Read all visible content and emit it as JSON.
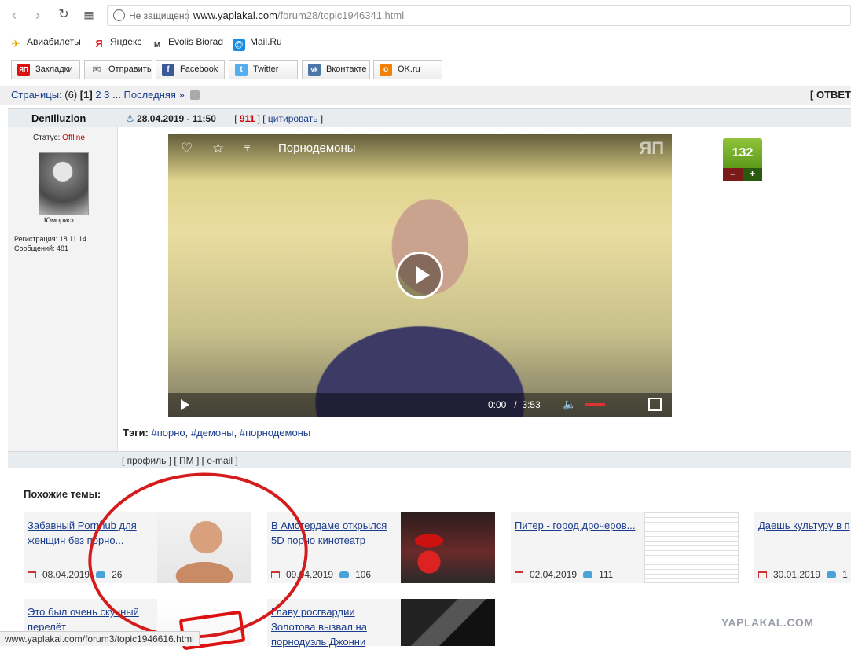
{
  "browser": {
    "security_label": "Не защищено",
    "url_domain": "www.yaplakal.com",
    "url_path": "/forum28/topic1946341.html",
    "bookmarks": [
      "Авиабилеты",
      "Яндекс",
      "Evolis Biorad",
      "Mail.Ru"
    ]
  },
  "share": {
    "buttons": [
      "Закладки",
      "Отправить",
      "Facebook",
      "Twitter",
      "Вконтакте",
      "OK.ru"
    ]
  },
  "pages": {
    "label": "Страницы:",
    "count": "(6)",
    "current": "[1]",
    "p2": "2",
    "p3": "3",
    "ellipsis": "...",
    "last": "Последняя »",
    "reply": "[ ОТВЕТ"
  },
  "post": {
    "author": "DenIlluzion",
    "datetime": "28.04.2019 - 11:50",
    "post_number": "911",
    "quote_label": "цитировать",
    "status_label": "Статус:",
    "status_value": "Offline",
    "rank": "Юморист",
    "registration": "Регистрация: 18.11.14",
    "messages": "Сообщений: 481",
    "rating": "132",
    "rating_minus": "–",
    "rating_plus": "+",
    "video": {
      "title": "Порнодемоны",
      "logo": "ЯП",
      "time_current": "0:00",
      "time_sep": "/",
      "time_total": "3:53"
    },
    "tags_label": "Тэги:",
    "tags": [
      "#порно",
      "#демоны",
      "#порнодемоны"
    ],
    "footer_links": [
      "профиль",
      "ПМ",
      "e-mail"
    ]
  },
  "similar": {
    "title": "Похожие темы:",
    "items": [
      {
        "title": "Забавный Pornhub для женщин без порно...",
        "date": "08.04.2019",
        "comments": "26"
      },
      {
        "title": "В Амстердаме открылся 5D порно кинотеатр",
        "date": "09.04.2019",
        "comments": "106"
      },
      {
        "title": "Питер - город дрочеров...",
        "date": "02.04.2019",
        "comments": "111"
      },
      {
        "title": "Даешь культуру в п",
        "date": "30.01.2019",
        "comments": "1"
      },
      {
        "title": "Это был очень скучный перелёт",
        "date": "",
        "comments": ""
      },
      {
        "title": "Главу росгвардии Золотова вызвал на порнодуэль Джонни",
        "date": "",
        "comments": ""
      }
    ]
  },
  "watermark": "YAPLAKAL.COM",
  "status_url": "www.yaplakal.com/forum3/topic1946616.html",
  "colors": {
    "link": "#1a3c8c",
    "offline": "#cc0000",
    "rating_green": "#6aa82a",
    "circle_red": "#d51c1c"
  }
}
